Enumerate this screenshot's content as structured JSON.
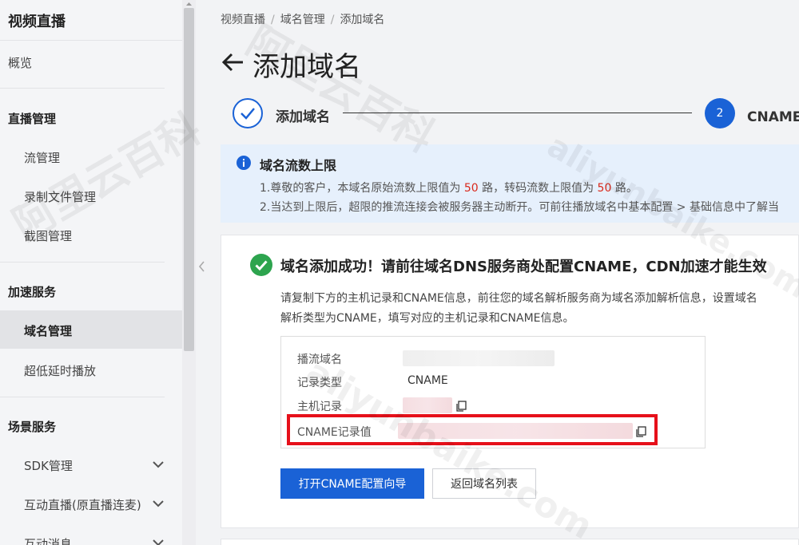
{
  "sidebar": {
    "title": "视频直播",
    "overview": "概览",
    "groups": {
      "live_mgmt": "直播管理",
      "accel": "加速服务",
      "scene": "场景服务"
    },
    "items": {
      "stream_mgmt": "流管理",
      "record_files": "录制文件管理",
      "snapshot": "截图管理",
      "domain_mgmt": "域名管理",
      "low_latency": "超低延时播放",
      "sdk": "SDK管理",
      "interactive_live": "互动直播(原直播连麦)",
      "interactive_msg": "互动消息"
    }
  },
  "breadcrumb": {
    "root": "视频直播",
    "parent": "域名管理",
    "current": "添加域名"
  },
  "page_title": "添加域名",
  "steps": {
    "step1_label": "添加域名",
    "step2_number": "2",
    "step2_label": "CNAME配"
  },
  "notice": {
    "title": "域名流数上限",
    "line1_prefix": "1.尊敬的客户，本域名原始流数上限值为 ",
    "line1_v1": "50",
    "line1_mid": " 路，转码流数上限值为 ",
    "line1_v2": "50",
    "line1_suffix": " 路。",
    "line2": "2.当达到上限后，超限的推流连接会被服务器主动断开。可前往播放域名中基本配置 > 基础信息中了解当"
  },
  "result": {
    "title": "域名添加成功！请前往域名DNS服务商处配置CNAME，CDN加速才能生效",
    "desc_line1": "请复制下方的主机记录和CNAME信息，前往您的域名解析服务商为域名添加解析信息，设置域名",
    "desc_line2": "解析类型为CNAME，填写对应的主机记录和CNAME信息。",
    "records": {
      "stream_domain_label": "播流域名",
      "record_type_label": "记录类型",
      "record_type_value": "CNAME",
      "host_record_label": "主机记录",
      "cname_value_label": "CNAME记录值"
    },
    "open_wizard_button": "打开CNAME配置向导",
    "back_button": "返回域名列表"
  },
  "watermark": {
    "cn": "阿里云百科",
    "en": "aliyunbaike.com"
  },
  "colors": {
    "accent": "#1a62d6",
    "success": "#2da44e",
    "highlight": "#e6101a",
    "notice_bg": "#e6f0fc",
    "limit_red": "#d9291c"
  }
}
